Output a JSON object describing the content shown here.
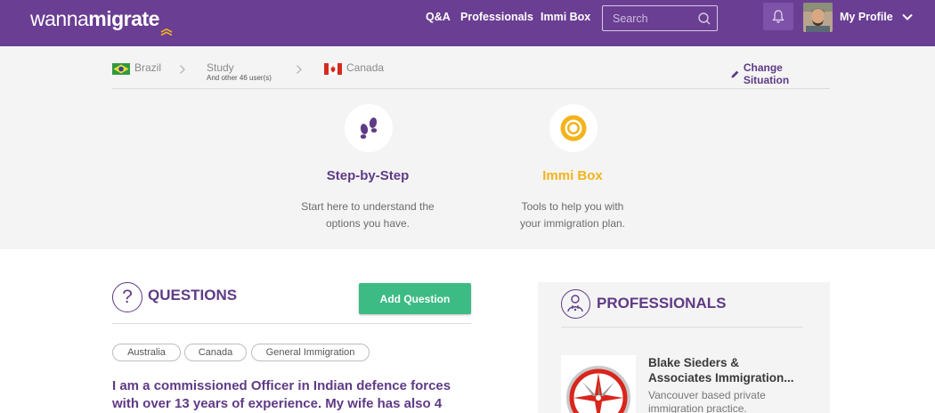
{
  "brand": {
    "part1": "wanna",
    "part2": "migrate"
  },
  "nav": {
    "qa": "Q&A",
    "professionals": "Professionals",
    "immibox": "Immi Box"
  },
  "search": {
    "placeholder": "Search"
  },
  "profile": {
    "label": "My Profile"
  },
  "situation": {
    "origin": "Brazil",
    "purpose": "Study",
    "purpose_sub": "And other 46 user(s)",
    "destination": "Canada",
    "change_label": "Change Situation"
  },
  "features": [
    {
      "title": "Step-by-Step",
      "desc_line1": "Start here to understand the",
      "desc_line2": "options you have.",
      "color": "#5f3a86"
    },
    {
      "title": "Immi Box",
      "desc_line1": "Tools to help you with",
      "desc_line2": "your immigration plan.",
      "color": "#f2b31c"
    }
  ],
  "questions": {
    "title": "QUESTIONS",
    "add_label": "Add Question",
    "tags": [
      "Australia",
      "Canada",
      "General Immigration"
    ],
    "first_question_line1": "I am a commissioned Officer in Indian defence forces",
    "first_question_line2": "with over 13 years of experience. My wife has also 4"
  },
  "professionals": {
    "title": "PROFESSIONALS",
    "name_line1": "Blake Sieders &",
    "name_line2": "Associates Immigration...",
    "desc_line1": "Vancouver based private",
    "desc_line2": "immigration practice."
  },
  "colors": {
    "header": "#6a3e92",
    "accent": "#5f3a86",
    "green": "#3dbb84",
    "gold": "#f2b31c"
  }
}
